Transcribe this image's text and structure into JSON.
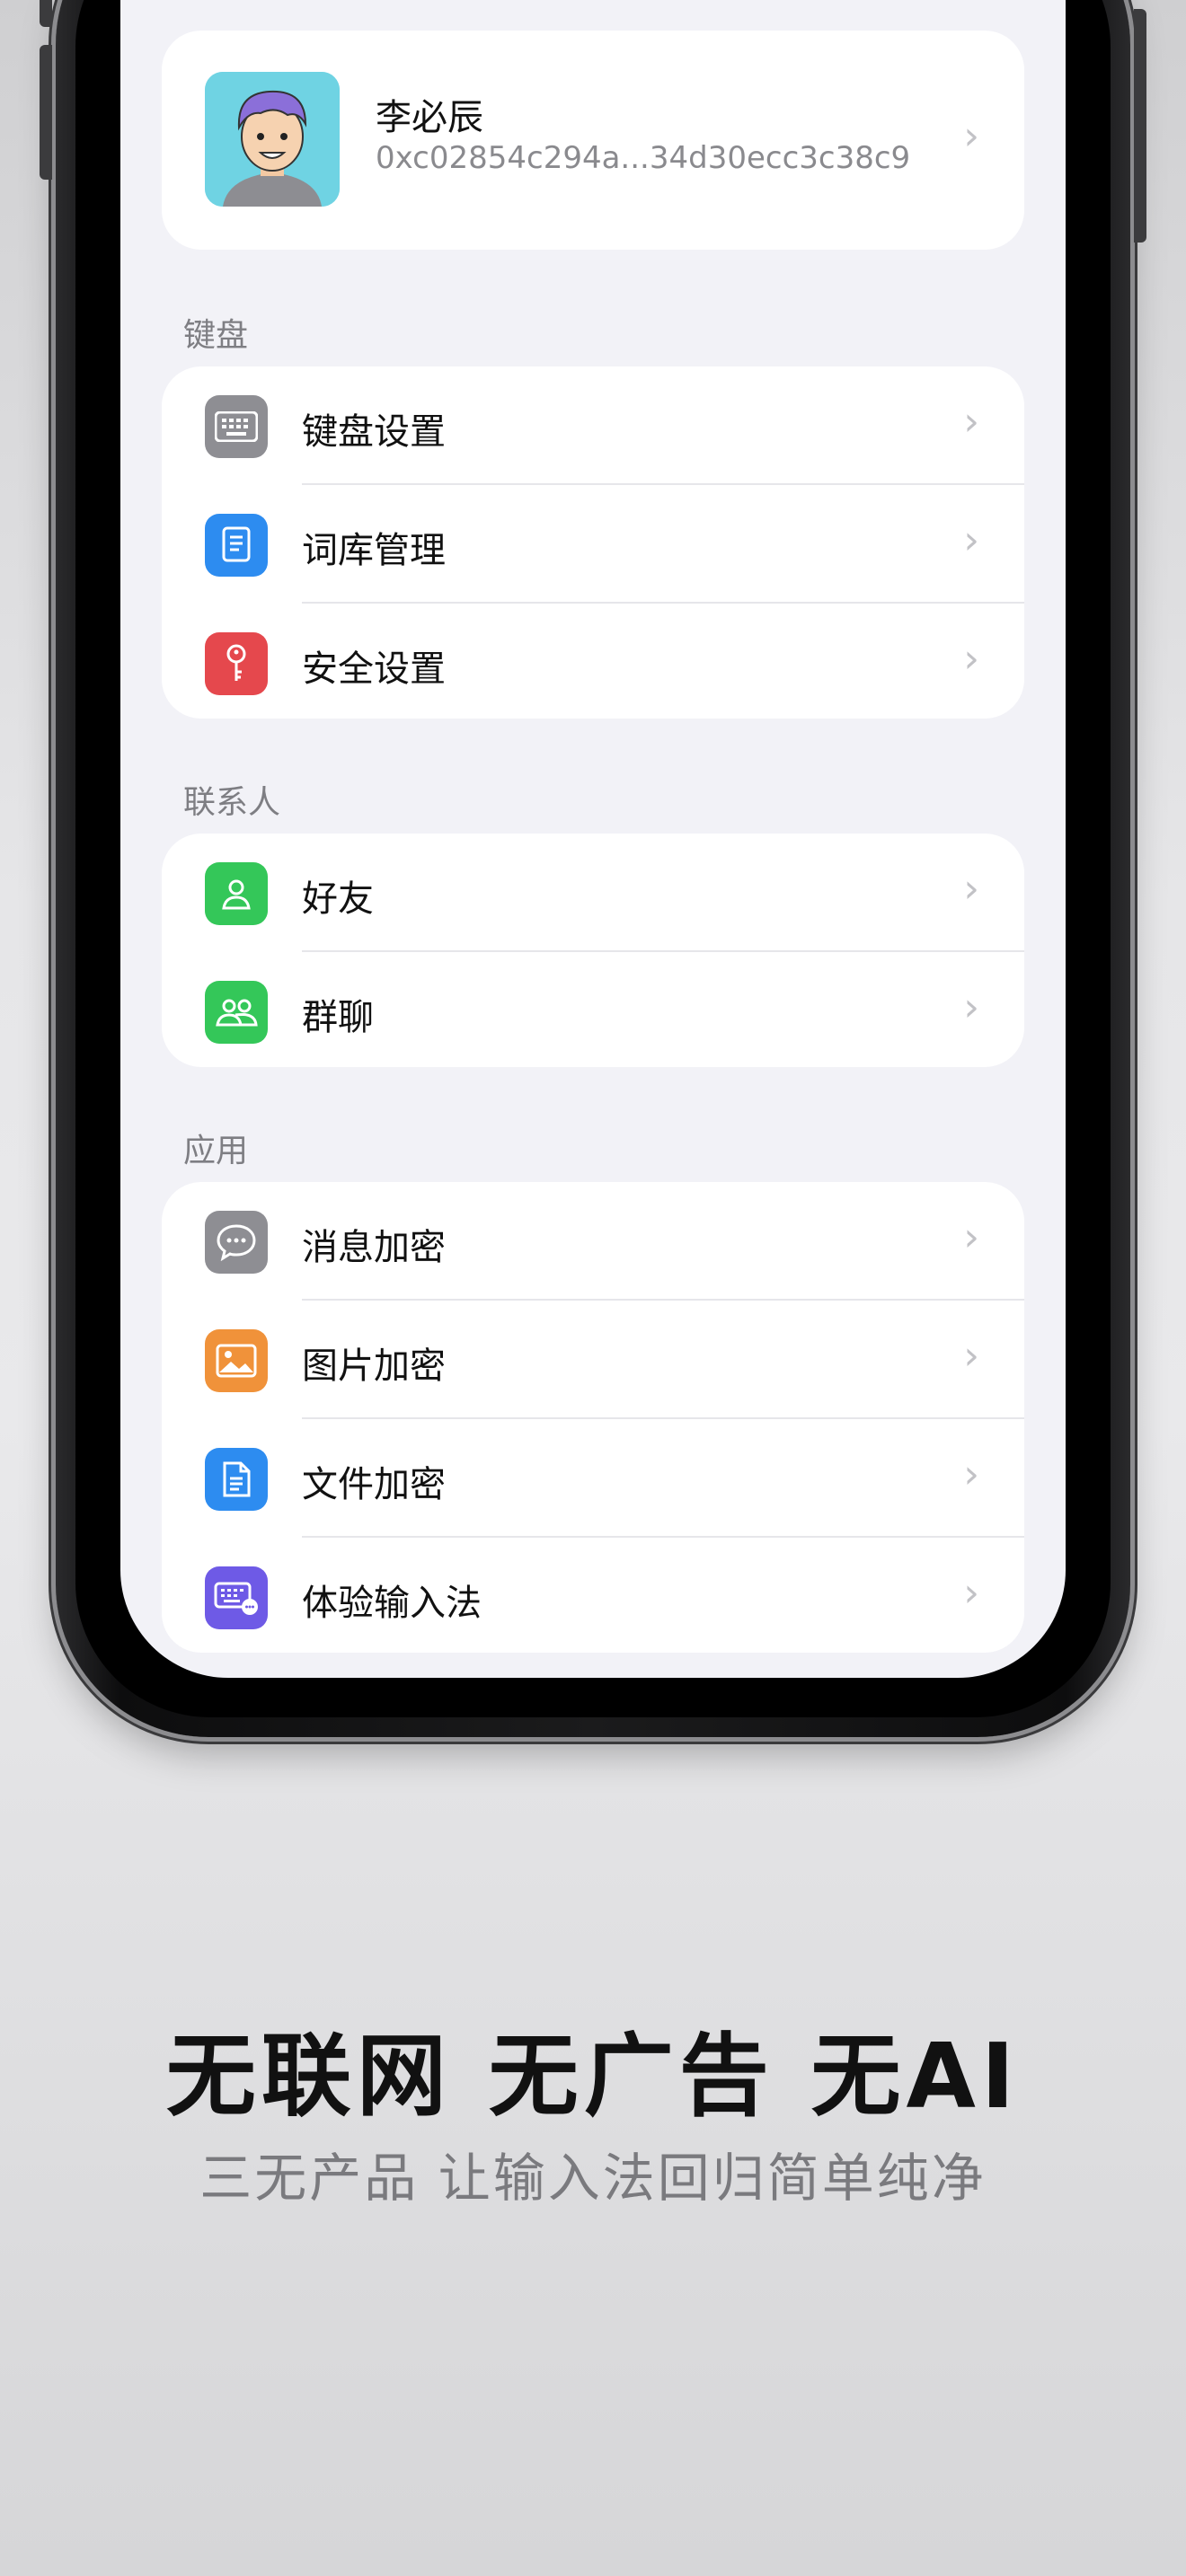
{
  "profile": {
    "name": "李必辰",
    "address": "0xc02854c294a...34d30ecc3c38c9"
  },
  "sections": {
    "keyboard": {
      "title": "键盘",
      "items": [
        {
          "label": "键盘设置",
          "icon": "keyboard-icon",
          "color": "#8e8e93"
        },
        {
          "label": "词库管理",
          "icon": "book-icon",
          "color": "#2d8cf0"
        },
        {
          "label": "安全设置",
          "icon": "key-icon",
          "color": "#e5484d"
        }
      ]
    },
    "contacts": {
      "title": "联系人",
      "items": [
        {
          "label": "好友",
          "icon": "person-icon",
          "color": "#34c759"
        },
        {
          "label": "群聊",
          "icon": "group-icon",
          "color": "#34c759"
        }
      ]
    },
    "apps": {
      "title": "应用",
      "items": [
        {
          "label": "消息加密",
          "icon": "message-icon",
          "color": "#8e8e93"
        },
        {
          "label": "图片加密",
          "icon": "image-icon",
          "color": "#f0923a"
        },
        {
          "label": "文件加密",
          "icon": "document-icon",
          "color": "#2d8cf0"
        },
        {
          "label": "体验输入法",
          "icon": "keyboard-chat-icon",
          "color": "#6e5ae6"
        }
      ]
    }
  },
  "promo": {
    "headline": "无联网 无广告 无AI",
    "subline": "三无产品 让输入法回归简单纯净"
  }
}
